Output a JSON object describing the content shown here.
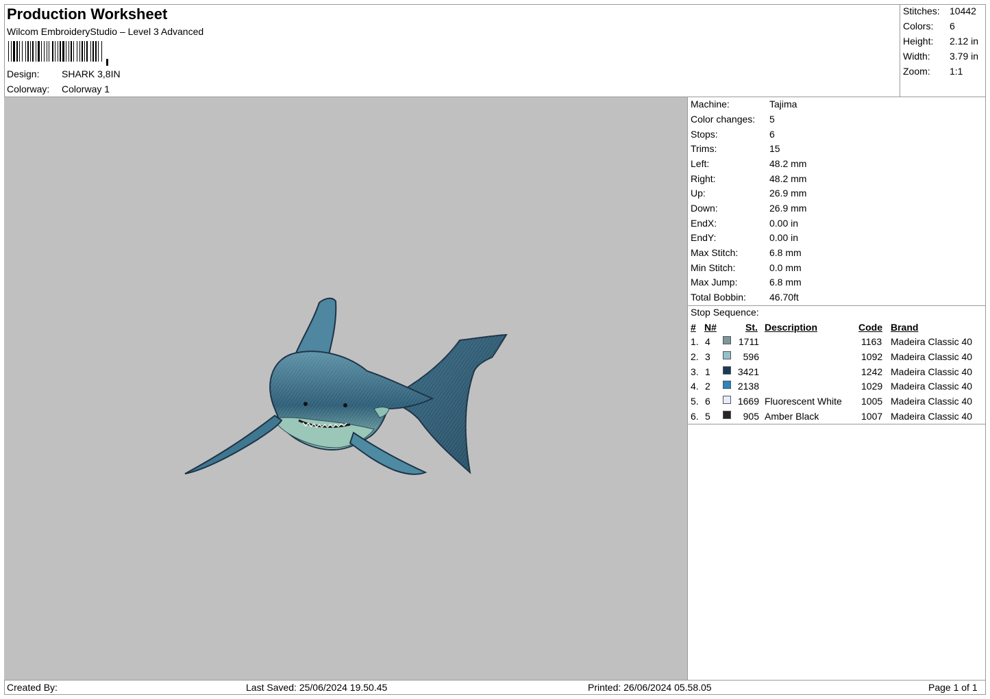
{
  "header": {
    "title": "Production Worksheet",
    "software": "Wilcom EmbroideryStudio – Level 3 Advanced",
    "design_label": "Design:",
    "design_value": "SHARK 3,8IN",
    "colorway_label": "Colorway:",
    "colorway_value": "Colorway 1"
  },
  "summary": [
    {
      "label": "Stitches:",
      "value": "10442"
    },
    {
      "label": "Colors:",
      "value": "6"
    },
    {
      "label": "Height:",
      "value": "2.12 in"
    },
    {
      "label": "Width:",
      "value": "3.79 in"
    },
    {
      "label": "Zoom:",
      "value": "1:1"
    }
  ],
  "properties": [
    {
      "label": "Machine:",
      "value": "Tajima"
    },
    {
      "label": "Color changes:",
      "value": "5"
    },
    {
      "label": "Stops:",
      "value": "6"
    },
    {
      "label": "Trims:",
      "value": "15"
    },
    {
      "label": "Left:",
      "value": "48.2 mm"
    },
    {
      "label": "Right:",
      "value": "48.2 mm"
    },
    {
      "label": "Up:",
      "value": "26.9 mm"
    },
    {
      "label": "Down:",
      "value": "26.9 mm"
    },
    {
      "label": "EndX:",
      "value": "0.00 in"
    },
    {
      "label": "EndY:",
      "value": "0.00 in"
    },
    {
      "label": "Max Stitch:",
      "value": "6.8 mm"
    },
    {
      "label": "Min Stitch:",
      "value": "0.0 mm"
    },
    {
      "label": "Max Jump:",
      "value": "6.8 mm"
    },
    {
      "label": "Total Bobbin:",
      "value": "46.70ft"
    }
  ],
  "stop_sequence": {
    "title": "Stop Sequence:",
    "columns": {
      "num": "#",
      "n": "N#",
      "st": "St.",
      "description": "Description",
      "code": "Code",
      "brand": "Brand"
    },
    "rows": [
      {
        "num": "1.",
        "n": "4",
        "color": "#7f969d",
        "st": "1711",
        "description": "",
        "code": "1163",
        "brand": "Madeira Classic 40"
      },
      {
        "num": "2.",
        "n": "3",
        "color": "#93c1cb",
        "st": "596",
        "description": "",
        "code": "1092",
        "brand": "Madeira Classic 40"
      },
      {
        "num": "3.",
        "n": "1",
        "color": "#1c3a55",
        "st": "3421",
        "description": "",
        "code": "1242",
        "brand": "Madeira Classic 40"
      },
      {
        "num": "4.",
        "n": "2",
        "color": "#2b86bf",
        "st": "2138",
        "description": "",
        "code": "1029",
        "brand": "Madeira Classic 40"
      },
      {
        "num": "5.",
        "n": "6",
        "color": "#e6ecfa",
        "st": "1669",
        "description": "Fluorescent White",
        "code": "1005",
        "brand": "Madeira Classic 40"
      },
      {
        "num": "6.",
        "n": "5",
        "color": "#262626",
        "st": "905",
        "description": "Amber Black",
        "code": "1007",
        "brand": "Madeira Classic 40"
      }
    ]
  },
  "footer": {
    "created_by": "Created By:",
    "last_saved": "Last Saved: 25/06/2024 19.50.45",
    "printed": "Printed: 26/06/2024 05.58.05",
    "page": "Page 1 of 1"
  }
}
